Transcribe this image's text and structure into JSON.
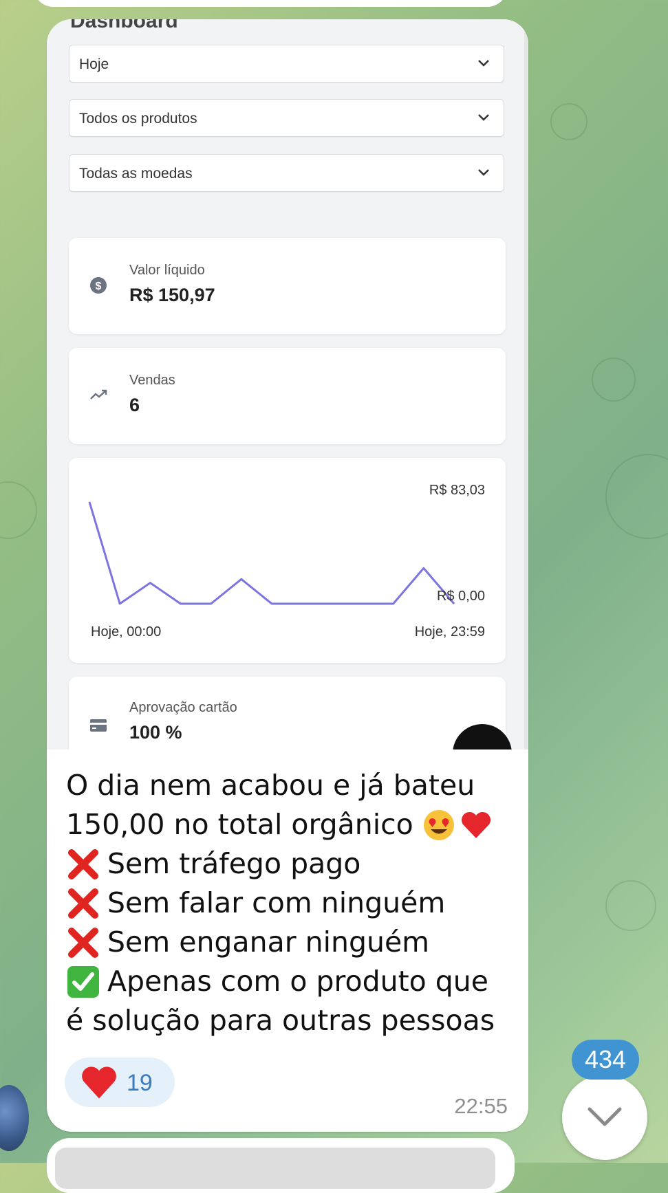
{
  "dashboard": {
    "title_cut": "Dashboard",
    "filters": [
      {
        "value": "Hoje"
      },
      {
        "value": "Todos os produtos"
      },
      {
        "value": "Todas as moedas"
      }
    ],
    "cards": {
      "net_value": {
        "label": "Valor líquido",
        "value": "R$ 150,97",
        "icon": "dollar-coin-icon"
      },
      "sales": {
        "label": "Vendas",
        "value": "6",
        "icon": "trending-up-icon"
      },
      "card_approval": {
        "label": "Aprovação cartão",
        "value": "100 %",
        "icon": "credit-card-icon"
      }
    }
  },
  "chart_data": {
    "type": "line",
    "title": "",
    "y_max_label": "R$ 83,03",
    "y_min_label": "R$ 0,00",
    "x_start_label": "Hoje, 00:00",
    "x_end_label": "Hoje, 23:59",
    "ylim": [
      0,
      83.03
    ],
    "color": "#7b74e0",
    "series": [
      {
        "values": [
          83.03,
          0,
          17,
          0,
          0,
          20,
          0,
          0,
          0,
          0,
          0,
          29,
          0
        ]
      }
    ]
  },
  "message": {
    "lines": [
      {
        "emoji": "",
        "text": "O dia nem acabou e já bateu"
      },
      {
        "emoji": "",
        "text": "150,00 no total orgânico",
        "trailing": [
          "smiling-heart-eyes-emoji",
          "red-heart-emoji"
        ]
      },
      {
        "emoji": "cross-mark-emoji",
        "text": "Sem tráfego pago"
      },
      {
        "emoji": "cross-mark-emoji",
        "text": "Sem falar com ninguém"
      },
      {
        "emoji": "cross-mark-emoji",
        "text": "Sem enganar ninguém"
      },
      {
        "emoji": "check-mark-emoji",
        "text": "Apenas com o produto que"
      },
      {
        "emoji": "",
        "text": "é solução para outras pessoas"
      }
    ],
    "reaction": {
      "icon": "red-heart-emoji",
      "count": "19"
    },
    "time": "22:55"
  },
  "scroll": {
    "unread_count": "434",
    "icon": "chevron-down-icon"
  },
  "colors": {
    "unread_badge": "#3f94d1",
    "reaction_bg": "#e4f0fa",
    "line": "#7b74e0"
  }
}
